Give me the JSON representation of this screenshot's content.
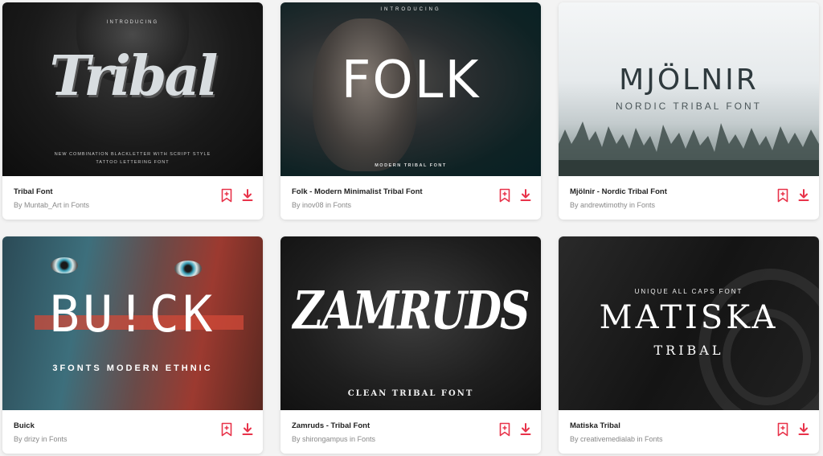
{
  "accent_color": "#e8334a",
  "icons": {
    "bookmark": "bookmark-plus-icon",
    "download": "download-icon"
  },
  "cards": [
    {
      "title": "Tribal Font",
      "byline": "By Muntab_Art in Fonts",
      "image": {
        "intro": "INTRODUCING",
        "word": "Tribal",
        "subtitle_line1": "NEW COMBINATION BLACKLETTER WITH SCRIPT STYLE",
        "subtitle_line2": "TATTOO LETTERING FONT"
      }
    },
    {
      "title": "Folk - Modern Minimalist Tribal Font",
      "byline": "By inov08 in Fonts",
      "image": {
        "intro": "INTRODUCING",
        "word": "FOLK",
        "subtitle": "MODERN TRIBAL FONT"
      }
    },
    {
      "title": "Mjölnir - Nordic Tribal Font",
      "byline": "By andrewtimothy in Fonts",
      "image": {
        "word": "MJÖLNIR",
        "subtitle": "NORDIC TRIBAL FONT"
      }
    },
    {
      "title": "Buick",
      "byline": "By drizy in Fonts",
      "image": {
        "word": "BU!CK",
        "subtitle": "3FONTS MODERN ETHNIC"
      }
    },
    {
      "title": "Zamruds - Tribal Font",
      "byline": "By shirongampus in Fonts",
      "image": {
        "word": "ZAMRUDS",
        "subtitle": "CLEAN TRIBAL FONT"
      }
    },
    {
      "title": "Matiska Tribal",
      "byline": "By creativemedialab in Fonts",
      "image": {
        "intro": "UNIQUE ALL CAPS FONT",
        "word": "MATISKA",
        "subtitle": "TRIBAL"
      }
    }
  ]
}
